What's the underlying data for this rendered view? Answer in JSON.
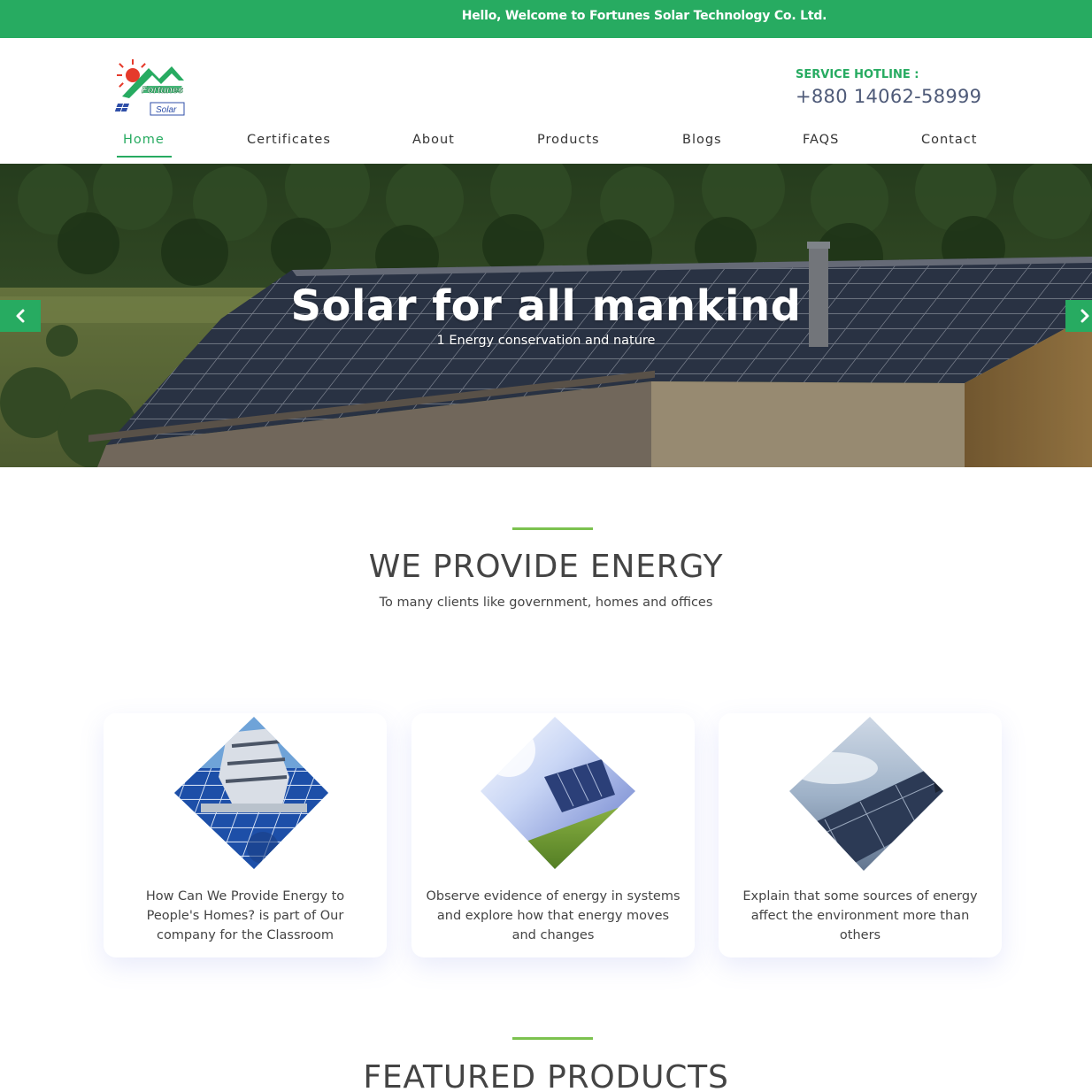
{
  "topbar": {
    "welcome_text": "Hello, Welcome to Fortunes Solar Technology Co. Ltd."
  },
  "header": {
    "logo": {
      "brand": "Fortunes",
      "sub": "Solar"
    },
    "hotline_label": "SERVICE HOTLINE :",
    "hotline_number": "+880 14062-58999"
  },
  "nav": {
    "items": [
      {
        "label": "Home",
        "active": true
      },
      {
        "label": "Certificates",
        "active": false
      },
      {
        "label": "About",
        "active": false
      },
      {
        "label": "Products",
        "active": false
      },
      {
        "label": "Blogs",
        "active": false
      },
      {
        "label": "FAQS",
        "active": false
      },
      {
        "label": "Contact",
        "active": false
      }
    ]
  },
  "hero": {
    "title": "Solar for all mankind",
    "subtitle": "1 Energy conservation and nature",
    "prev_icon": "chevron-left-icon",
    "next_icon": "chevron-right-icon"
  },
  "provide_section": {
    "title": "WE PROVIDE ENERGY",
    "subtitle": "To many clients like government, homes and offices",
    "cards": [
      {
        "text": "How Can We Provide Energy to People's Homes? is part of Our company for the Classroom"
      },
      {
        "text": "Observe evidence of energy in systems and explore how that energy moves and changes"
      },
      {
        "text": "Explain that some sources of energy affect the environment more than others"
      }
    ]
  },
  "featured_section": {
    "title": "FEATURED PRODUCTS"
  },
  "colors": {
    "brand_green": "#27ab61",
    "accent_line": "#7cc24f",
    "hotline_blue": "#4e5a78"
  }
}
